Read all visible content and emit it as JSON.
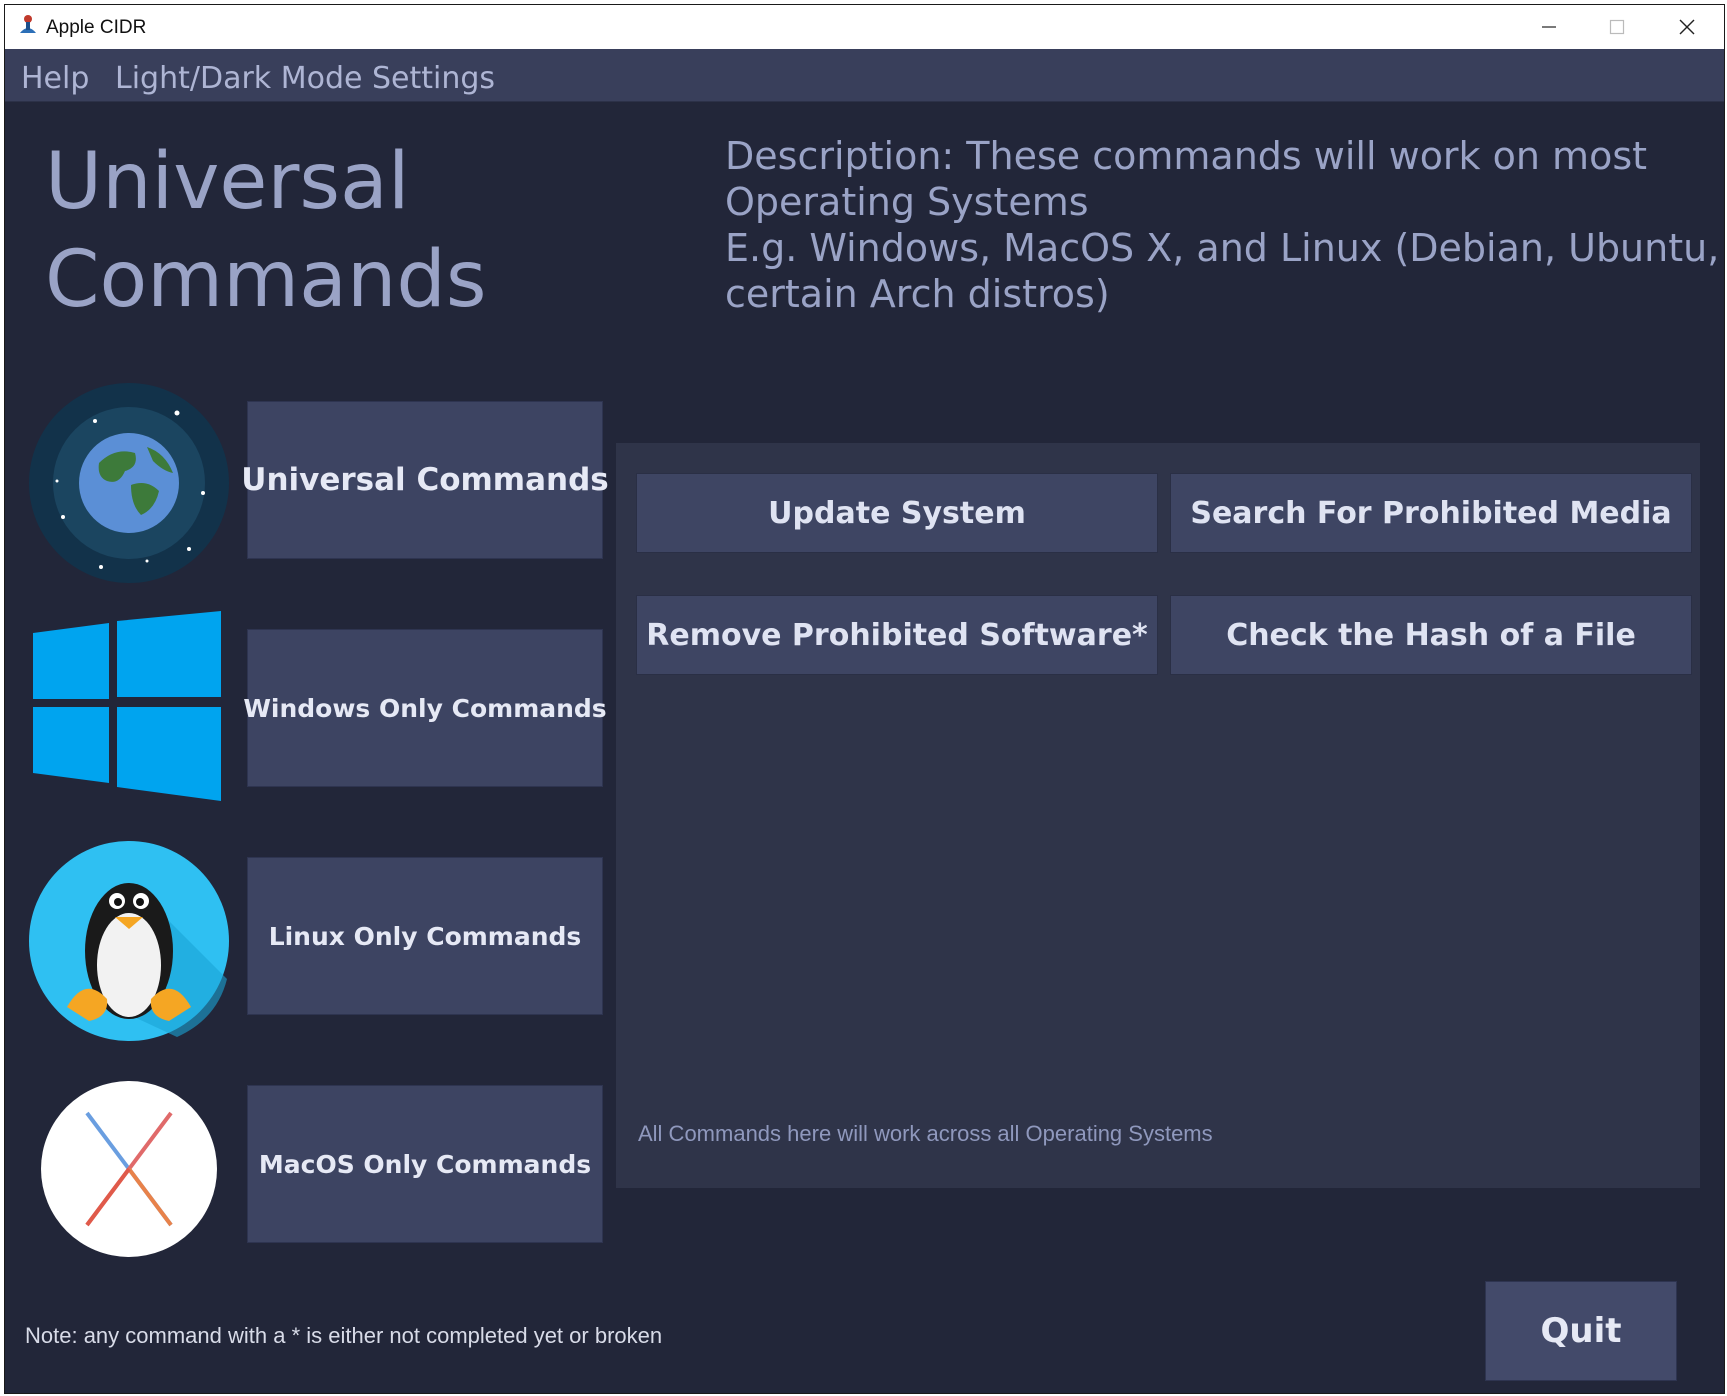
{
  "window": {
    "title": "Apple CIDR",
    "controls": {
      "minimize": "minimize-icon",
      "maximize": "maximize-icon",
      "close": "close-icon"
    }
  },
  "menubar": {
    "items": [
      {
        "label": "Help"
      },
      {
        "label": "Light/Dark Mode Settings"
      }
    ]
  },
  "header": {
    "title_line1": "Universal",
    "title_line2": "Commands",
    "description_lines": [
      "Description: These commands will work on most",
      "Operating Systems",
      "E.g. Windows, MacOS X, and Linux (Debian, Ubuntu,",
      "certain Arch distros)"
    ]
  },
  "sidebar": {
    "items": [
      {
        "label": "Universal Commands",
        "icon": "globe-icon"
      },
      {
        "label": "Windows Only Commands",
        "icon": "windows-logo-icon"
      },
      {
        "label": "Linux Only Commands",
        "icon": "linux-penguin-icon"
      },
      {
        "label": "MacOS Only Commands",
        "icon": "macos-x-icon"
      }
    ]
  },
  "panel": {
    "commands": [
      {
        "label": "Update System"
      },
      {
        "label": "Search For Prohibited Media"
      },
      {
        "label": "Remove Prohibited Software*"
      },
      {
        "label": "Check the Hash of a File"
      }
    ],
    "note": "All Commands here will work across all Operating Systems"
  },
  "footer": {
    "note": "Note: any command with a * is either not completed yet or broken",
    "quit_label": "Quit"
  },
  "colors": {
    "background": "#222639",
    "menubar": "#393f5b",
    "button": "#3d4462",
    "panel": "#2f3449",
    "text_muted": "#9aa3c6"
  }
}
